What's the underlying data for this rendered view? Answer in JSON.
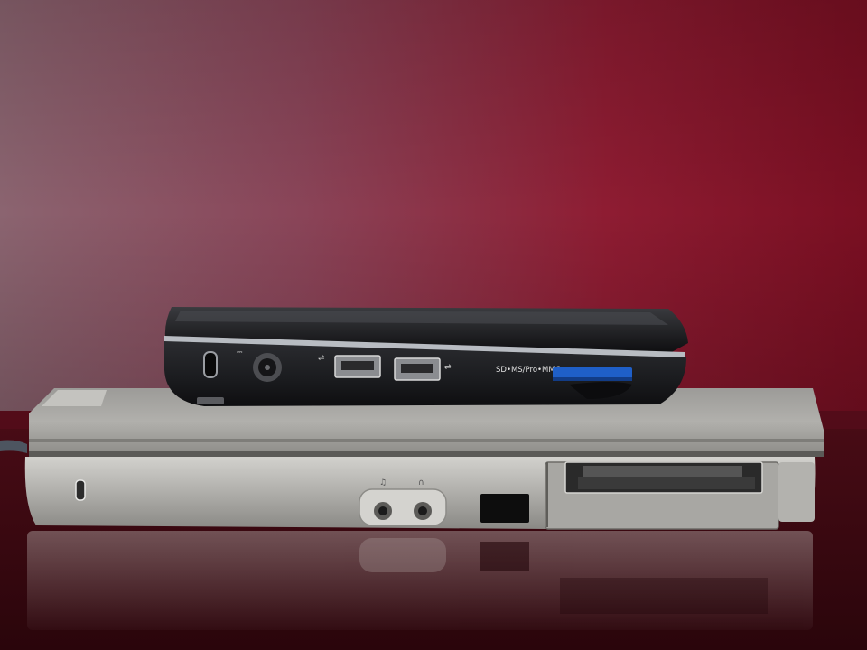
{
  "photo": {
    "subject": "Netbook stacked on a larger laptop, side view",
    "labels": {
      "card_reader": "SD•MS/Pro•MMC"
    },
    "colors": {
      "wall_left": "#8a5c68",
      "wall_right": "#8a1428",
      "desk": "#3d0a12",
      "netbook_body": "#1e1f22",
      "netbook_trim": "#b8bcc2",
      "laptop_body": "#a7a6a2",
      "card_accent": "#1f5fc8"
    }
  }
}
